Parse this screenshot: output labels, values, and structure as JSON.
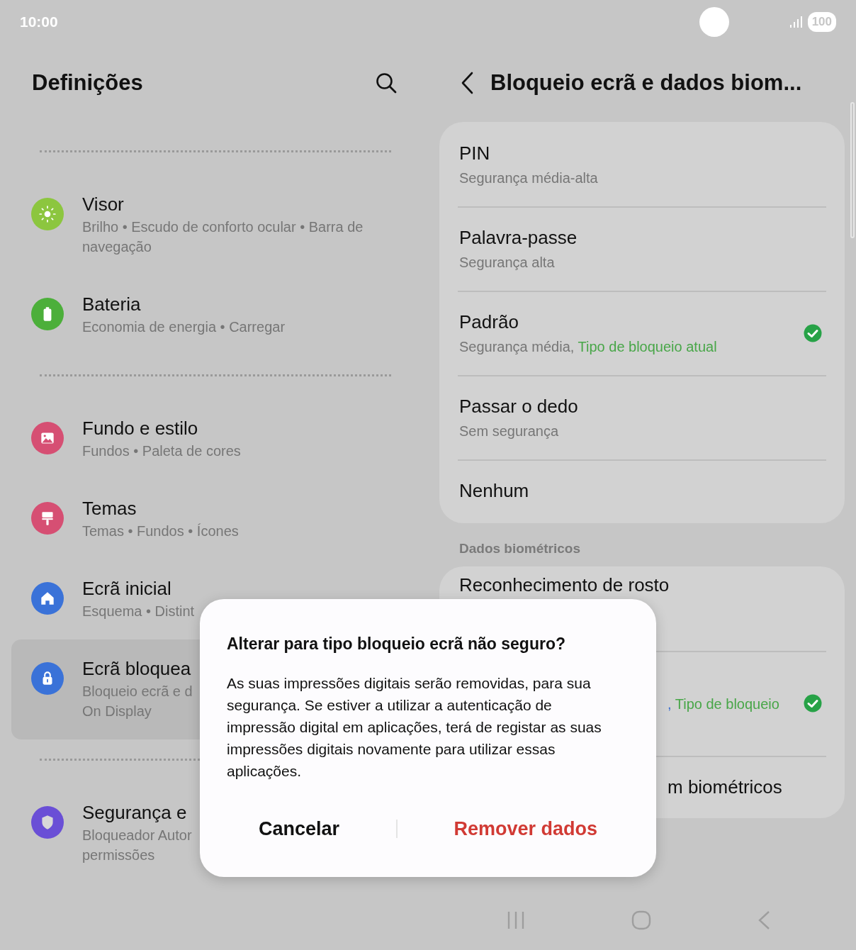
{
  "status_bar": {
    "time": "10:00",
    "battery": "100"
  },
  "settings": {
    "title": "Definições",
    "groups": [
      [
        {
          "title": "Visor",
          "subtitle": "Brilho  •  Escudo de conforto ocular  •  Barra de navegação",
          "color": "#8cc63f",
          "selected": false
        },
        {
          "title": "Bateria",
          "subtitle": "Economia de energia  •  Carregar",
          "color": "#4caf3a",
          "selected": false
        }
      ],
      [
        {
          "title": "Fundo e estilo",
          "subtitle": "Fundos  •  Paleta de cores",
          "color": "#d64f73",
          "selected": false
        },
        {
          "title": "Temas",
          "subtitle": "Temas  •  Fundos  •  Ícones",
          "color": "#d64f73",
          "selected": false
        },
        {
          "title": "Ecrã inicial",
          "subtitle": "Esquema  •  Distint",
          "color": "#3a72d8",
          "selected": false
        },
        {
          "title": "Ecrã bloquea",
          "subtitle": "Bloqueio ecrã e d",
          "subtitle_2": "On Display",
          "color": "#3a72d8",
          "selected": true
        }
      ],
      [
        {
          "title": "Segurança e",
          "subtitle": "Bloqueador Autor",
          "subtitle_2": "permissões",
          "color": "#6a4fd6",
          "selected": false
        }
      ]
    ]
  },
  "detail": {
    "title": "Bloqueio ecrã e dados biom...",
    "lock_types": [
      {
        "title": "PIN",
        "subtitle": "Segurança média-alta",
        "checked": false
      },
      {
        "title": "Palavra-passe",
        "subtitle": "Segurança alta",
        "checked": false
      },
      {
        "title": "Padrão",
        "subtitle": "Segurança média,",
        "note": "Tipo de bloqueio atual",
        "checked": true
      },
      {
        "title": "Passar o dedo",
        "subtitle": "Sem segurança",
        "checked": false
      },
      {
        "title": "Nenhum",
        "checked": false
      }
    ],
    "section": "Dados biométricos",
    "biometrics": [
      {
        "title": "Reconhecimento de rosto",
        "checked": false
      },
      {
        "subtitle": ",",
        "note": "Tipo de bloqueio",
        "checked": true
      },
      {
        "title": "m biométricos",
        "checked": false
      }
    ]
  },
  "dialog": {
    "title": "Alterar para tipo bloqueio ecrã não seguro?",
    "message": "As suas impressões digitais serão removidas, para sua segurança. Se estiver a utilizar a autenticação de impressão digital em aplicações, terá de registar as suas impressões digitais novamente para utilizar essas aplicações.",
    "buttons": [
      {
        "label": "Cancelar",
        "kind": "neutral"
      },
      {
        "label": "Remover dados",
        "kind": "danger"
      }
    ]
  }
}
